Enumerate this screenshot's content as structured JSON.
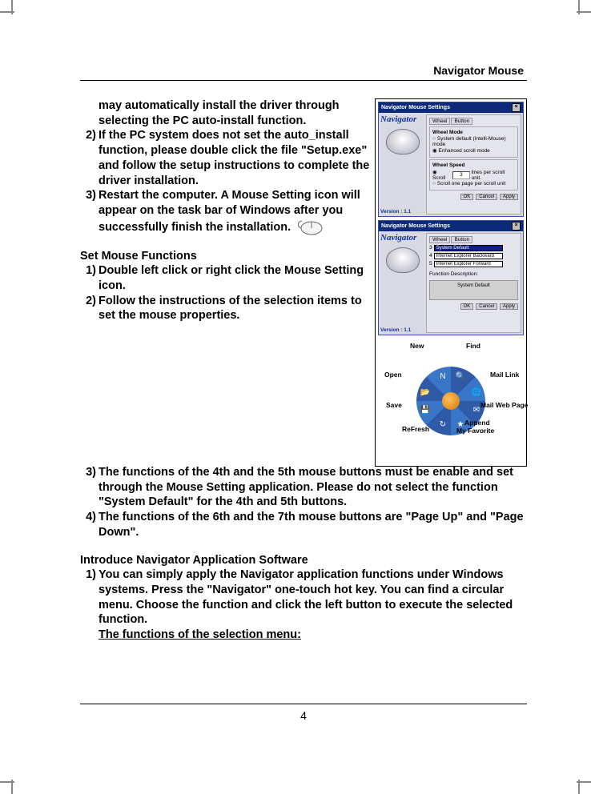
{
  "header": {
    "product_name": "Navigator Mouse"
  },
  "body": {
    "continued_para": "may automatically install the driver through selecting the PC auto-install function.",
    "install": {
      "n2": "2)",
      "p2": "If the PC system does not set the auto_install function, please double click the file \"Setup.exe\" and follow the setup instructions to complete the driver installation.",
      "n3": "3)",
      "p3": "Restart the computer. A Mouse Setting icon will appear on the task bar of Windows after you successfully finish the installation."
    },
    "section1_title": "Set Mouse Functions",
    "section1": {
      "n1": "1)",
      "p1": "Double left click or right click the Mouse Setting icon.",
      "n2": "2)",
      "p2": "Follow the instructions of the selection items to set the mouse properties.",
      "n3": "3)",
      "p3": "The functions of the 4th and the 5th mouse buttons must be enable and set through the Mouse Setting application.  Please do not select the function \"System Default\" for the 4th and 5th buttons.",
      "n4": "4)",
      "p4": "The functions of the 6th and the 7th mouse buttons are \"Page Up\" and \"Page Down\"."
    },
    "section2_title": "Introduce Navigator Application Software",
    "section2": {
      "n1": "1)",
      "p1": "You can simply apply the Navigator application functions under Windows systems.  Press the \"Navigator\" one-touch hot key.  You can find a circular menu.  Choose the function and click the left button to execute the selected function.",
      "subhead": "The functions of the selection menu:"
    }
  },
  "figure": {
    "panel_title": "Navigator Mouse Settings",
    "brand": "Navigator",
    "version": "Version : 1.1",
    "p1": {
      "tab1": "Wheel",
      "tab2": "Button",
      "g1_title": "Wheel Mode",
      "g1_o1": "System default (Intelli-Mouse) mode",
      "g1_o2": "Enhanced scroll mode",
      "g2_title": "Wheel Speed",
      "g2_o1_a": "Scroll",
      "g2_o1_b": "lines per scroll unit.",
      "g2_o1_val": "3",
      "g2_o2": "Scroll one page per scroll unit",
      "btn_ok": "OK",
      "btn_cancel": "Cancel",
      "btn_apply": "Apply"
    },
    "p2": {
      "tab1": "Wheel",
      "tab2": "Button",
      "row3_n": "3",
      "row3_sel": "System Default",
      "row4_n": "4",
      "row4_sel": "Internet Explorer Backward",
      "row5_n": "5",
      "row5_sel": "Internet Explorer Forward",
      "fn_label": "Function Description:",
      "fn_val": "System Default",
      "btn_ok": "OK",
      "btn_cancel": "Cancel",
      "btn_apply": "Apply"
    }
  },
  "wheel": {
    "labels": {
      "new": "New",
      "find": "Find",
      "open": "Open",
      "mail_link": "Mail Link",
      "save": "Save",
      "mail_web": "Mail Web Page",
      "refresh": "ReFresh",
      "append": "Append",
      "my_fav": "My Favorite"
    }
  },
  "footer": {
    "page_number": "4"
  }
}
